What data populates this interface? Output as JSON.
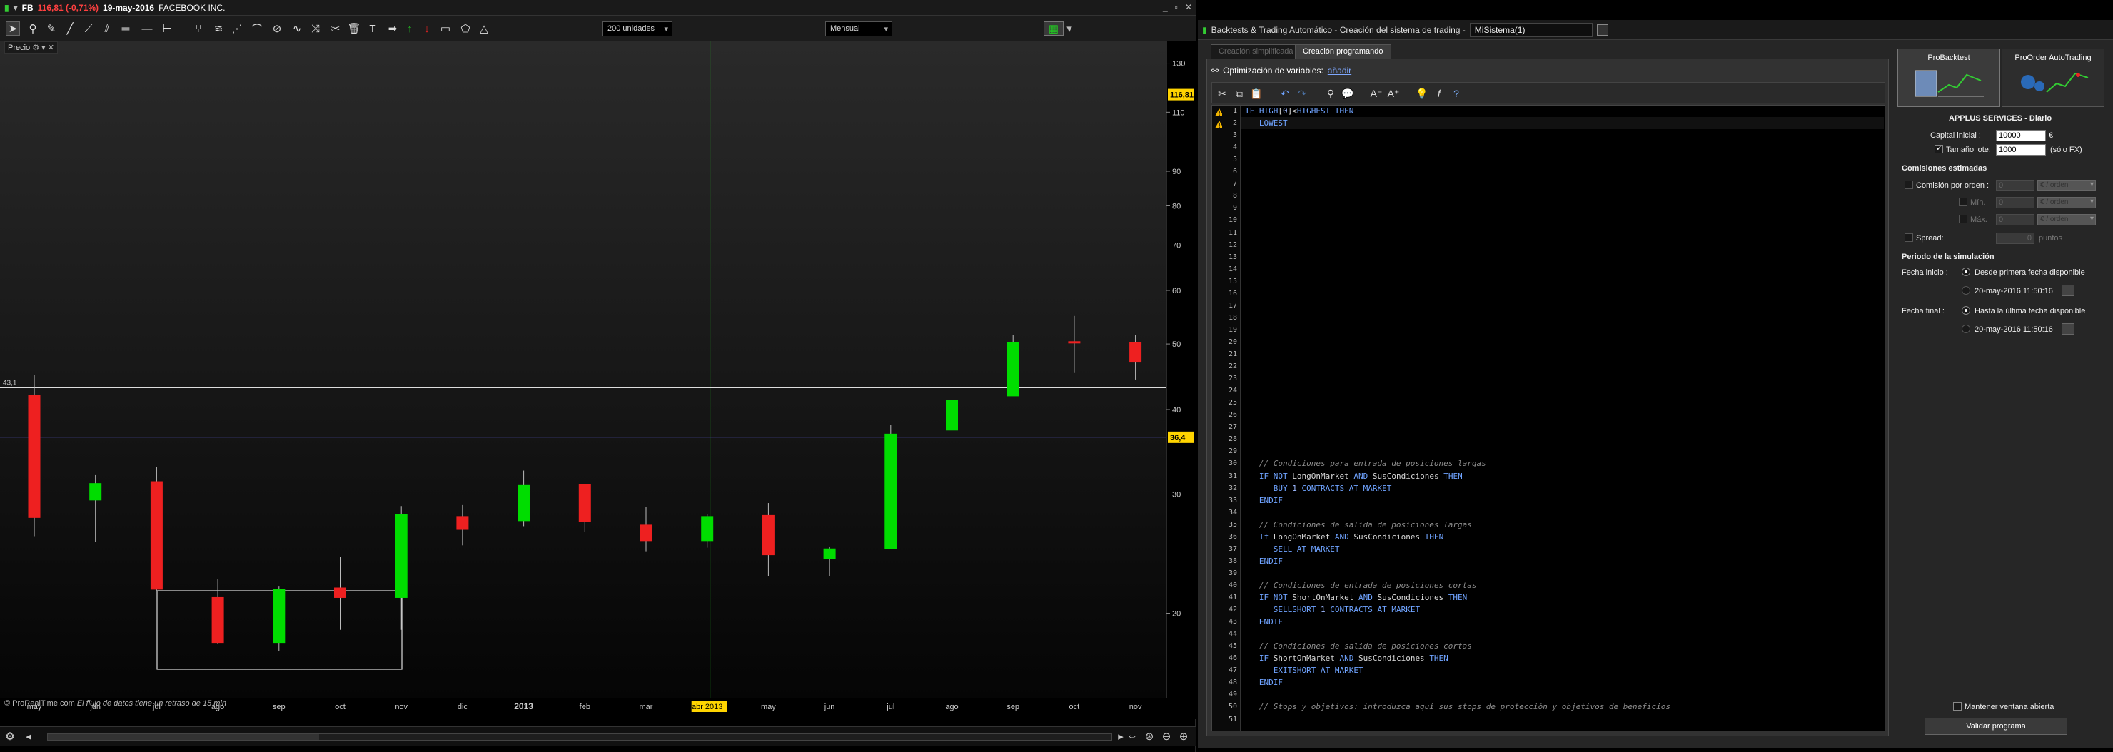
{
  "chart_window": {
    "symbol": "FB",
    "last_change": "116,81 (-0,71%)",
    "date": "19-may-2016",
    "company": "FACEBOOK INC.",
    "units_select": "200 unidades",
    "period_select": "Mensual",
    "price_label": "Precio",
    "credit_site": "© ProRealTime.com",
    "credit_note": "El flujo de datos tiene un retraso de 15 min",
    "window_buttons": [
      "_",
      "▫",
      "✕"
    ]
  },
  "chart_data": {
    "type": "candlestick",
    "y_scale": "log",
    "ylim": [
      15,
      140
    ],
    "y_ticks": [
      20,
      30,
      40,
      50,
      60,
      70,
      80,
      90,
      110,
      130
    ],
    "x_labels": [
      "may",
      "jun",
      "jul",
      "ago",
      "sep",
      "oct",
      "nov",
      "dic",
      "2013",
      "feb",
      "mar",
      "abr 2013",
      "may",
      "jun",
      "jul",
      "ago",
      "sep",
      "oct",
      "nov"
    ],
    "candles": [
      {
        "month": "may",
        "open": 42.0,
        "high": 45.0,
        "low": 26.0,
        "close": 27.7
      },
      {
        "month": "jun",
        "open": 29.4,
        "high": 32.0,
        "low": 25.5,
        "close": 31.1
      },
      {
        "month": "jul",
        "open": 31.3,
        "high": 32.9,
        "low": 21.6,
        "close": 21.7
      },
      {
        "month": "ago",
        "open": 21.1,
        "high": 22.5,
        "low": 18.0,
        "close": 18.1
      },
      {
        "month": "sep",
        "open": 18.1,
        "high": 21.9,
        "low": 17.6,
        "close": 21.7
      },
      {
        "month": "oct",
        "open": 21.8,
        "high": 24.2,
        "low": 18.9,
        "close": 21.1
      },
      {
        "month": "nov",
        "open": 21.1,
        "high": 28.8,
        "low": 18.9,
        "close": 28.0
      },
      {
        "month": "dic",
        "open": 27.8,
        "high": 28.9,
        "low": 25.2,
        "close": 26.6
      },
      {
        "month": "2013",
        "open": 27.4,
        "high": 32.5,
        "low": 26.9,
        "close": 30.9
      },
      {
        "month": "feb",
        "open": 31.0,
        "high": 31.0,
        "low": 26.4,
        "close": 27.3
      },
      {
        "month": "mar",
        "open": 27.0,
        "high": 28.7,
        "low": 24.7,
        "close": 25.6
      },
      {
        "month": "abr 2013",
        "open": 25.6,
        "high": 28.0,
        "low": 25.0,
        "close": 27.8
      },
      {
        "month": "may",
        "open": 27.9,
        "high": 29.1,
        "low": 22.7,
        "close": 24.4
      },
      {
        "month": "jun",
        "open": 24.1,
        "high": 25.1,
        "low": 22.7,
        "close": 24.9
      },
      {
        "month": "jul",
        "open": 24.9,
        "high": 38.0,
        "low": 24.9,
        "close": 36.8
      },
      {
        "month": "ago",
        "open": 37.3,
        "high": 42.3,
        "low": 37.0,
        "close": 41.3
      },
      {
        "month": "sep",
        "open": 41.9,
        "high": 51.6,
        "low": 41.9,
        "close": 50.2
      },
      {
        "month": "oct",
        "open": 50.4,
        "high": 55.0,
        "low": 45.3,
        "close": 50.2
      },
      {
        "month": "nov",
        "open": 50.2,
        "high": 51.6,
        "low": 44.3,
        "close": 47.0
      }
    ],
    "horizontal_line": {
      "value": 43.1,
      "label": "43,1"
    },
    "price_markers": [
      {
        "value": 116.81,
        "label": "116,81",
        "color": "#ffd400"
      },
      {
        "value": 36.4,
        "label": "36,4",
        "color": "#ffd400"
      }
    ],
    "highlight_x_label": "abr 2013",
    "up_color": "#00dd00",
    "down_color": "#ee2020"
  },
  "backtest": {
    "window_title": "Backtests & Trading Automático - Creación del sistema de trading  -",
    "system_name": "MiSistema(1)",
    "tab_simplified": "Creación simplificada",
    "tab_programming": "Creación programando",
    "optimization_label": "Optimización de variables:",
    "optimization_link": "añadir",
    "code_lines": [
      {
        "n": "1",
        "warn": true,
        "text": "IF HIGH[0]<HIGHEST THEN"
      },
      {
        "n": "2",
        "warn": true,
        "text": "   LOWEST"
      },
      {
        "n": "30",
        "text": "   // Condiciones para entrada de posiciones largas"
      },
      {
        "n": "31",
        "text": "   IF NOT LongOnMarket AND SusCondiciones THEN"
      },
      {
        "n": "32",
        "text": "      BUY 1 CONTRACTS AT MARKET"
      },
      {
        "n": "33",
        "text": "   ENDIF"
      },
      {
        "n": "35",
        "text": "   // Condiciones de salida de posiciones largas"
      },
      {
        "n": "36",
        "text": "   If LongOnMarket AND SusCondiciones THEN"
      },
      {
        "n": "37",
        "text": "      SELL AT MARKET"
      },
      {
        "n": "38",
        "text": "   ENDIF"
      },
      {
        "n": "40",
        "text": "   // Condiciones de entrada de posiciones cortas"
      },
      {
        "n": "41",
        "text": "   IF NOT ShortOnMarket AND SusCondiciones THEN"
      },
      {
        "n": "42",
        "text": "      SELLSHORT 1 CONTRACTS AT MARKET"
      },
      {
        "n": "43",
        "text": "   ENDIF"
      },
      {
        "n": "45",
        "text": "   // Condiciones de salida de posiciones cortas"
      },
      {
        "n": "46",
        "text": "   IF ShortOnMarket AND SusCondiciones THEN"
      },
      {
        "n": "47",
        "text": "      EXITSHORT AT MARKET"
      },
      {
        "n": "48",
        "text": "   ENDIF"
      },
      {
        "n": "50",
        "text": "   // Stops y objetivos: introduzca aquí sus stops de protección y objetivos de beneficios"
      }
    ],
    "line_count": 51
  },
  "side": {
    "tab_probacktest": "ProBacktest",
    "tab_proorder": "ProOrder AutoTrading",
    "instrument": "APPLUS SERVICES - Diario",
    "capital_label": "Capital inicial :",
    "capital_value": "10000",
    "currency": "€",
    "lot_label": "Tamaño lote:",
    "lot_value": "1000",
    "lot_note": "(sólo FX)",
    "commissions_header": "Comisiones estimadas",
    "commission_order_label": "Comisión por orden :",
    "commission_order_value": "0",
    "commission_order_unit": "€ / orden",
    "min_label": "Mín.",
    "min_value": "0",
    "min_unit": "€ / orden",
    "max_label": "Máx.",
    "max_value": "0",
    "max_unit": "€ / orden",
    "spread_label": "Spread:",
    "spread_value": "0",
    "spread_unit": "puntos",
    "period_header": "Periodo de la simulación",
    "start_label": "Fecha inicio :",
    "start_option1": "Desde primera fecha disponible",
    "start_option2": "20-may-2016 11:50:16",
    "end_label": "Fecha final :",
    "end_option1": "Hasta la última fecha disponible",
    "end_option2": "20-may-2016 11:50:16",
    "keep_open": "Mantener ventana abierta",
    "validate": "Validar programa"
  }
}
